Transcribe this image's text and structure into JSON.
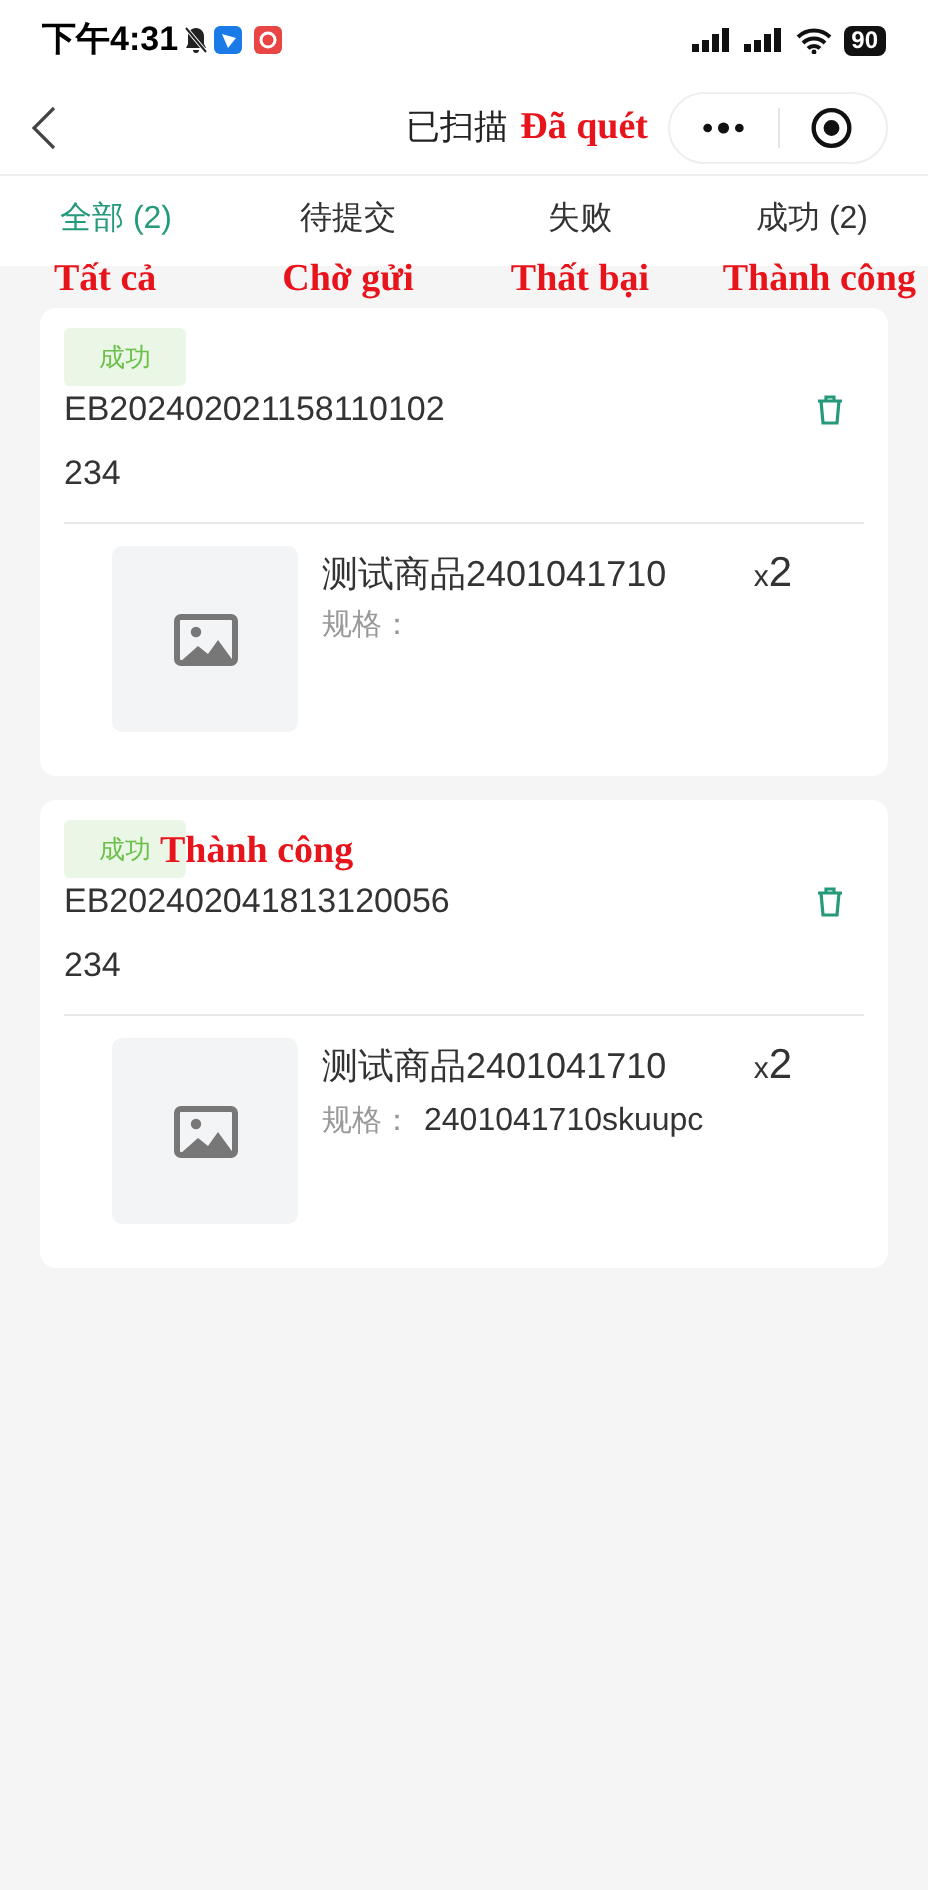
{
  "status_bar": {
    "time": "下午4:31",
    "battery": "90"
  },
  "nav": {
    "title": "已扫描",
    "title_note": "Đã quét"
  },
  "tabs": [
    {
      "label": "全部 (2)",
      "note": "Tất cả",
      "selected": true
    },
    {
      "label": "待提交",
      "note": "Chờ gửi",
      "selected": false
    },
    {
      "label": "失败",
      "note": "Thất bại",
      "selected": false
    },
    {
      "label": "成功 (2)",
      "note": "Thành công",
      "selected": false
    }
  ],
  "records": [
    {
      "status": "成功",
      "code": "EB202402021158110102",
      "remark": "234",
      "item": {
        "name": "测试商品2401041710",
        "spec_label": "规格：",
        "qty_prefix": "x",
        "qty": "2"
      }
    },
    {
      "status": "成功",
      "status_note": "Thành công",
      "code": "EB202402041813120056",
      "remark": "234",
      "item": {
        "name": "测试商品2401041710",
        "spec_label": "规格：",
        "spec": "2401041710skuupc",
        "qty_prefix": "x",
        "qty": "2"
      }
    }
  ]
}
